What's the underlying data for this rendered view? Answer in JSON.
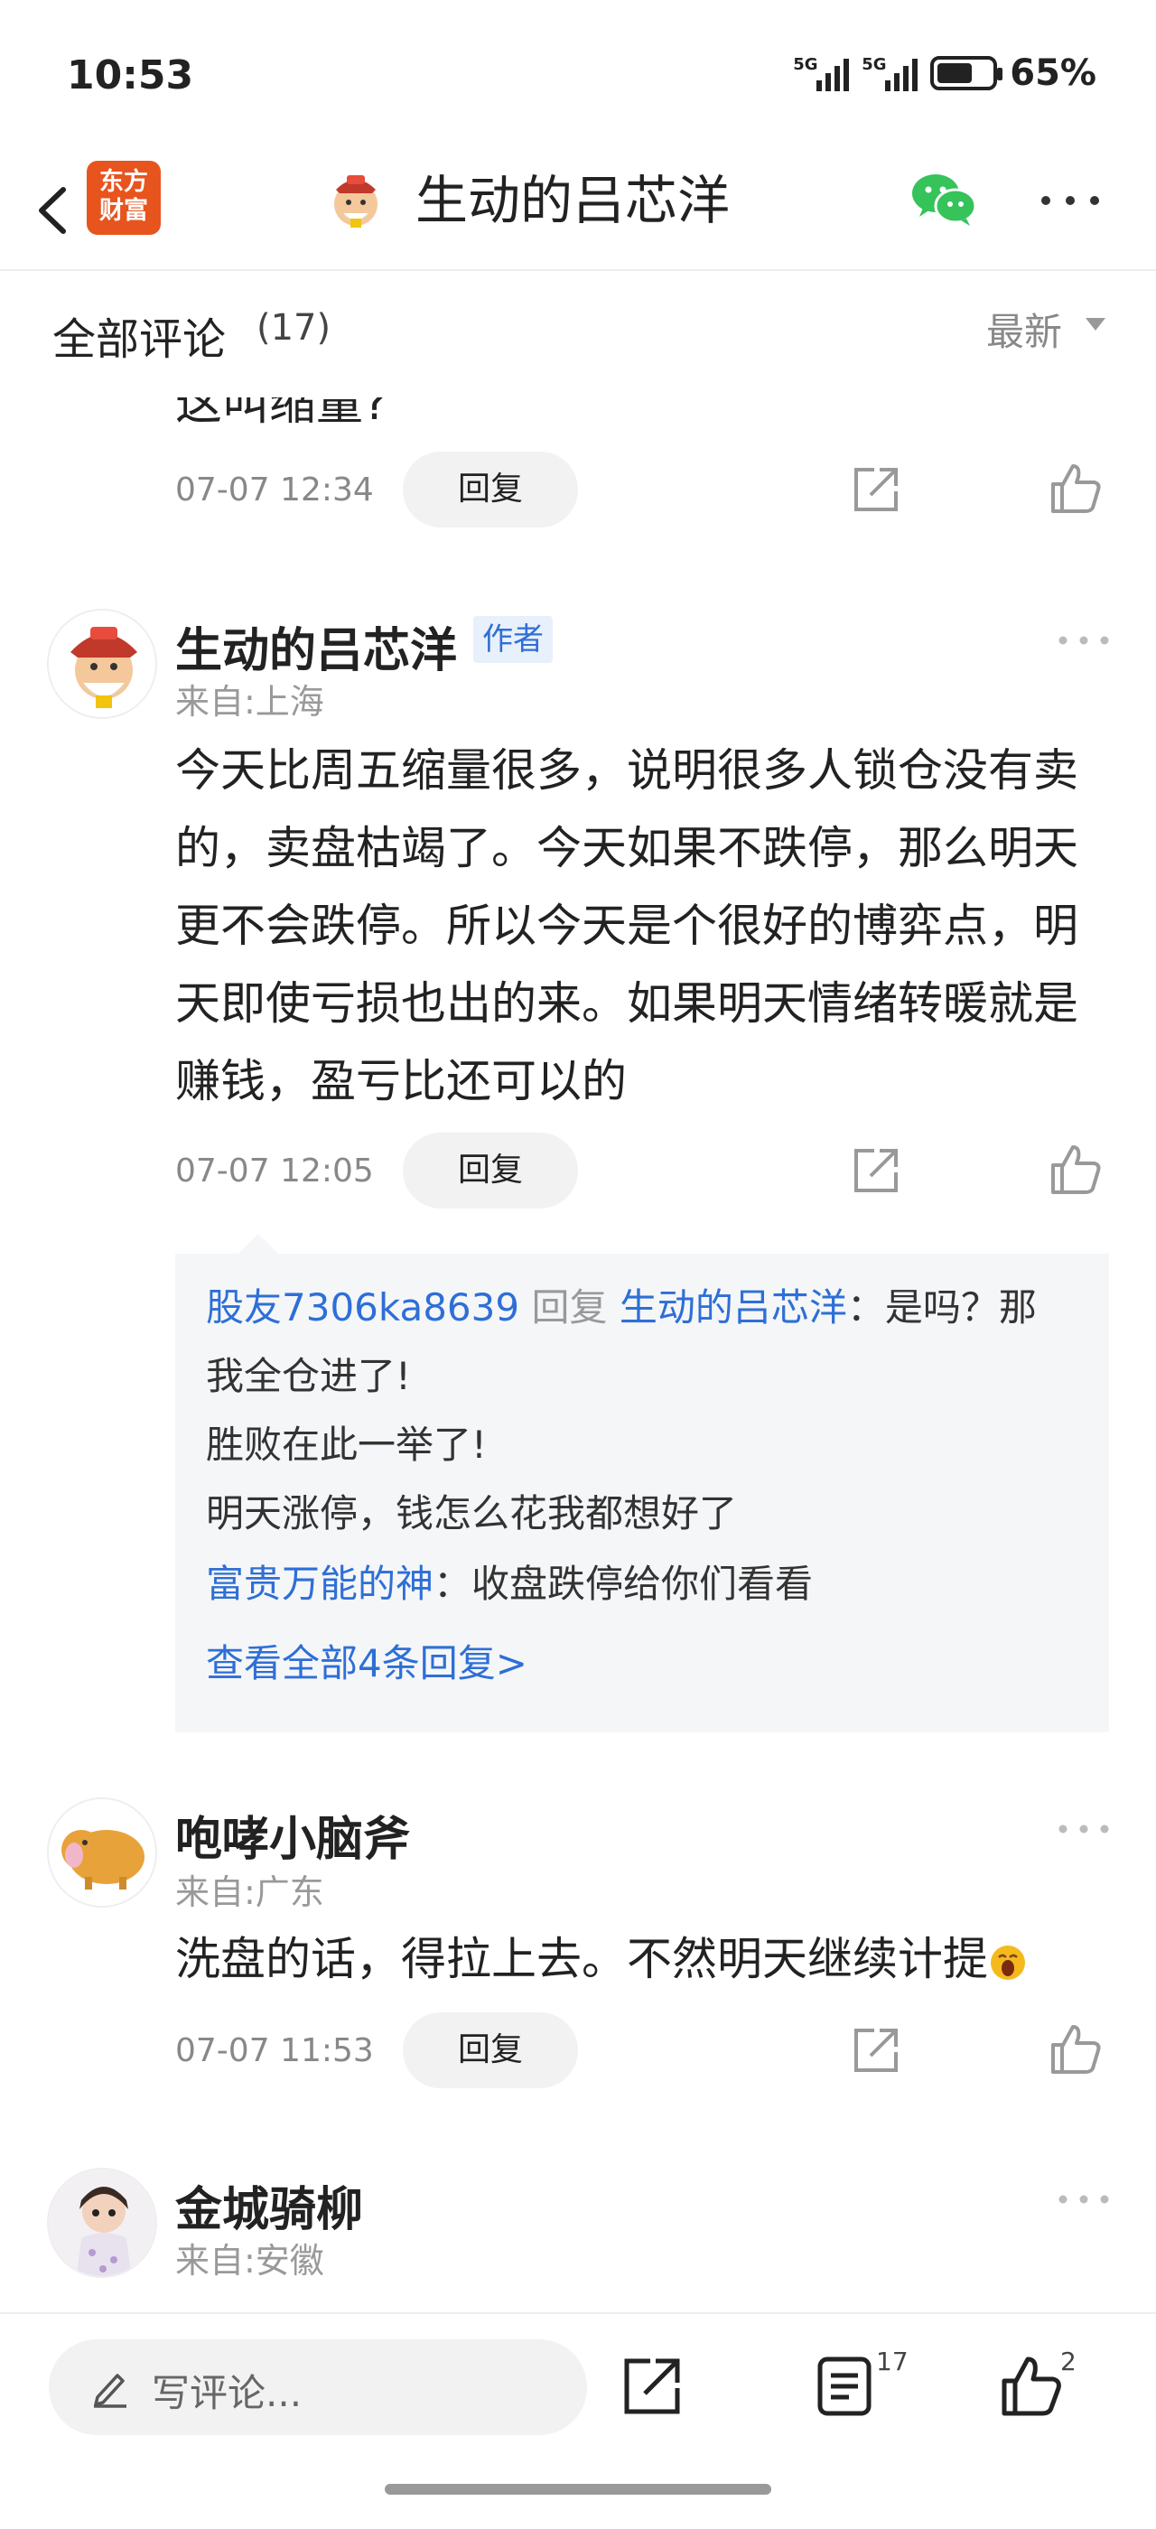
{
  "status": {
    "time": "10:53",
    "signal1": "5G",
    "signal2": "5G",
    "battery_pct": "65%",
    "battery_level": 0.65
  },
  "nav": {
    "logo_line1": "东方",
    "logo_line2": "财富",
    "title": "生动的吕芯洋"
  },
  "section": {
    "title": "全部评论",
    "count": "(17)",
    "sort": "最新"
  },
  "comments": [
    {
      "partial_text": "这叫缩量?",
      "time": "07-07 12:34",
      "reply": "回复"
    },
    {
      "user": "生动的吕芯洋",
      "badge": "作者",
      "location": "来自:上海",
      "text": "今天比周五缩量很多，说明很多人锁仓没有卖的，卖盘枯竭了。今天如果不跌停，那么明天更不会跌停。所以今天是个很好的博弈点，明天即使亏损也出的来。如果明天情绪转暖就是赚钱，盈亏比还可以的",
      "time": "07-07 12:05",
      "reply": "回复",
      "replies": {
        "r1_user": "股友7306ka8639",
        "r1_mid": " 回复 ",
        "r1_target": "生动的吕芯洋",
        "r1_text": "：是吗？那",
        "r1_l2": "我全仓进了!",
        "r1_l3": "胜败在此一举了!",
        "r1_l4": "明天涨停，钱怎么花我都想好了",
        "r2_user": "富贵万能的神",
        "r2_text": "：收盘跌停给你们看看",
        "view_all": "查看全部4条回复>"
      }
    },
    {
      "user": "咆哮小脑斧",
      "location": "来自:广东",
      "text": "洗盘的话，得拉上去。不然明天继续计提",
      "time": "07-07 11:53",
      "reply": "回复"
    },
    {
      "user": "金城骑柳",
      "location": "来自:安徽"
    }
  ],
  "bottom": {
    "write_placeholder": "写评论...",
    "comment_count": "17",
    "like_count": "2"
  }
}
